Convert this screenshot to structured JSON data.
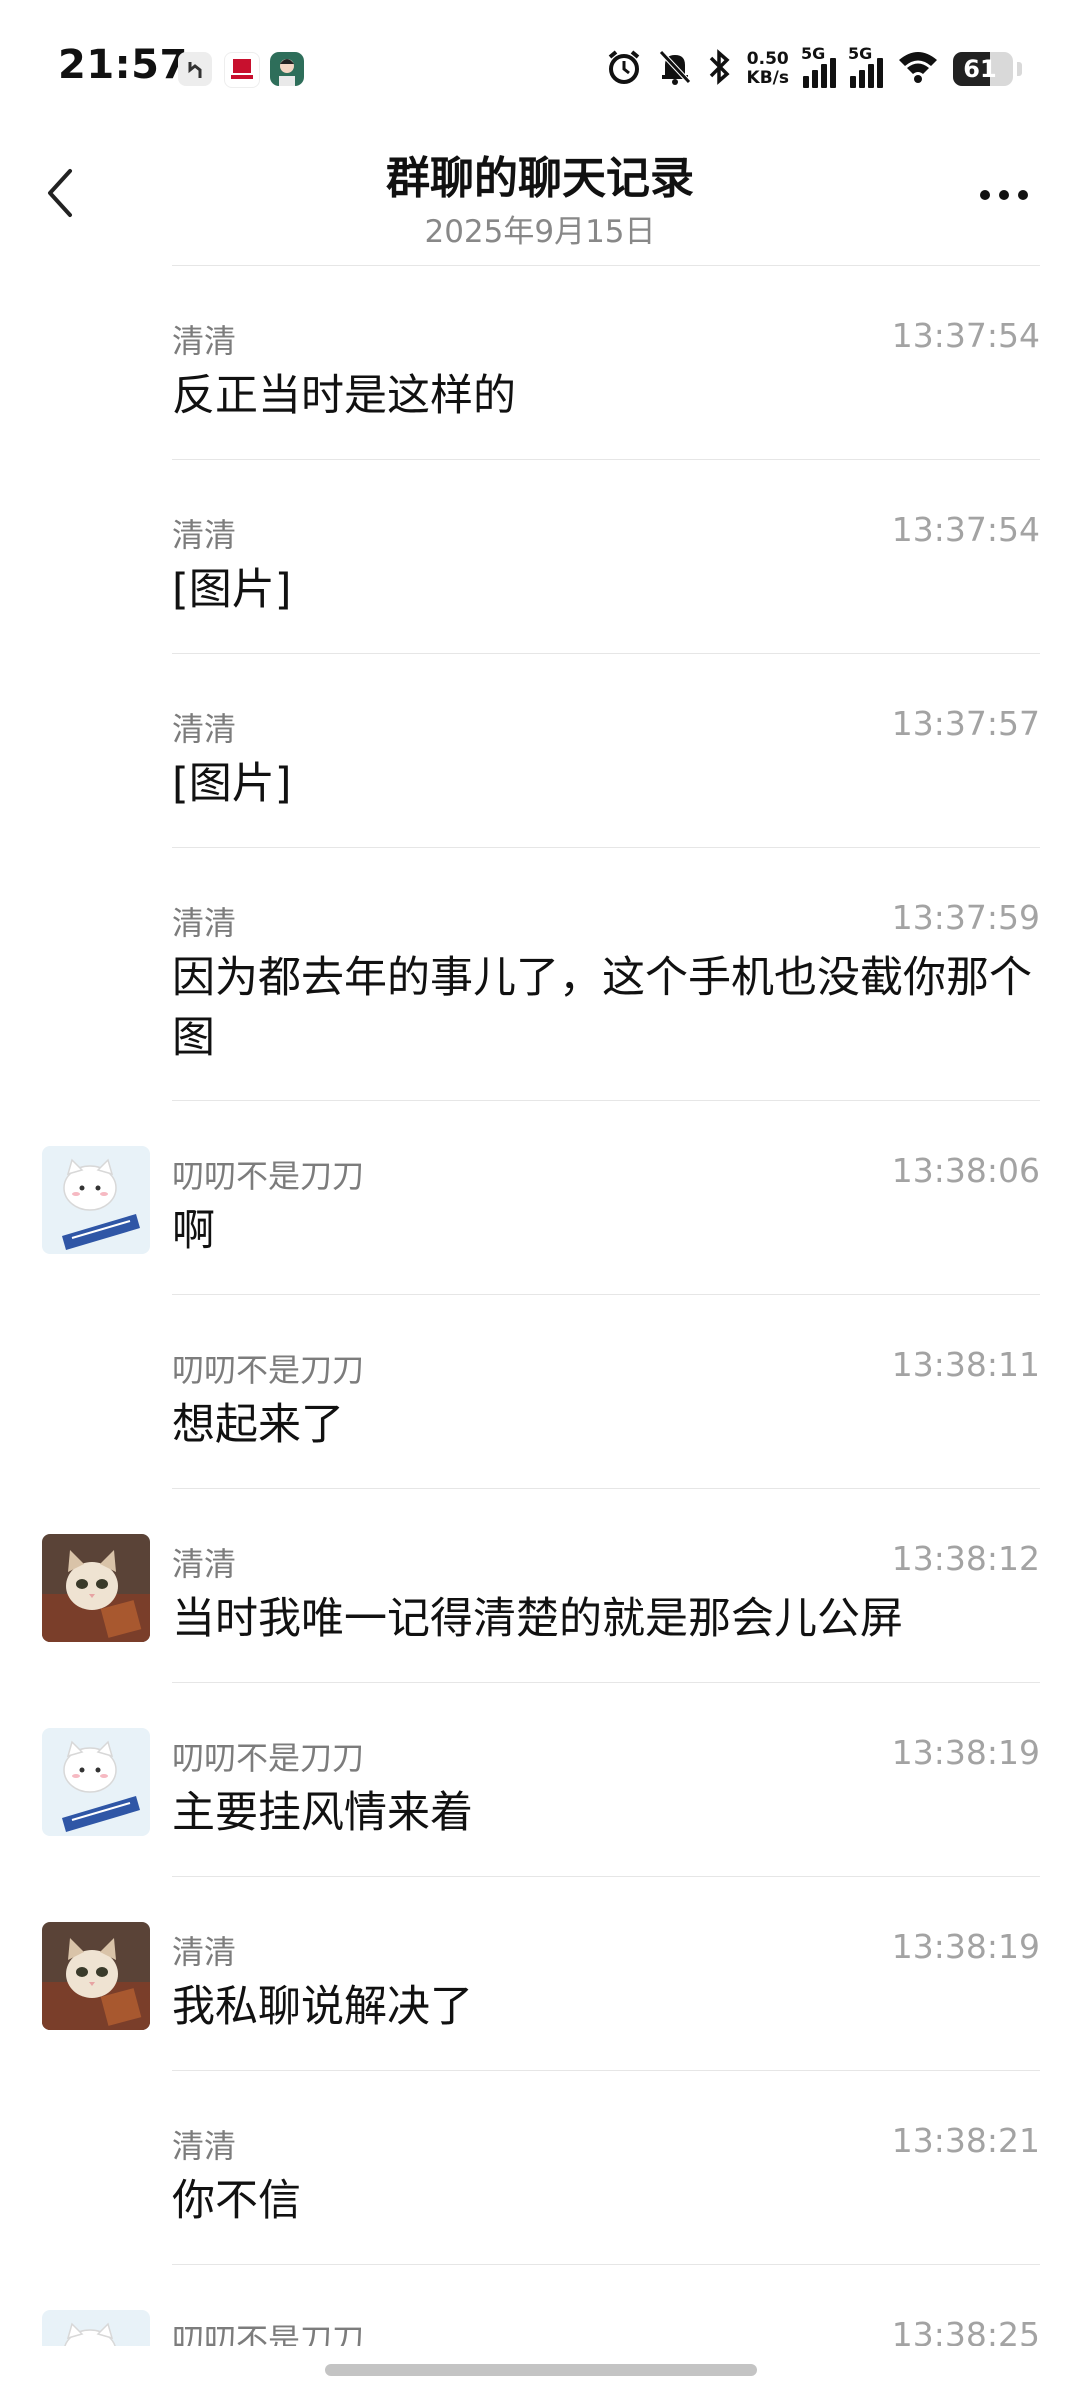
{
  "status_bar": {
    "time": "21:57",
    "net_speed_value": "0.50",
    "net_speed_unit": "KB/s",
    "signal1_label": "5G",
    "signal2_label": "5G",
    "battery": "61",
    "battery_level": 0.61
  },
  "nav": {
    "title": "群聊的聊天记录",
    "subtitle": "2025年9月15日"
  },
  "messages": [
    {
      "sender": "清清",
      "time": "13:37:54",
      "text": "反正当时是这样的",
      "avatar": "none"
    },
    {
      "sender": "清清",
      "time": "13:37:54",
      "text": "[图片]",
      "avatar": "none"
    },
    {
      "sender": "清清",
      "time": "13:37:57",
      "text": "[图片]",
      "avatar": "none"
    },
    {
      "sender": "清清",
      "time": "13:37:59",
      "text": "因为都去年的事儿了，这个手机也没截你那个图",
      "avatar": "none"
    },
    {
      "sender": "叨叨不是刀刀",
      "time": "13:38:06",
      "text": "啊",
      "avatar": "white-cat-sign"
    },
    {
      "sender": "叨叨不是刀刀",
      "time": "13:38:11",
      "text": "想起来了",
      "avatar": "none"
    },
    {
      "sender": "清清",
      "time": "13:38:12",
      "text": "当时我唯一记得清楚的就是那会儿公屏",
      "avatar": "kitten-photo"
    },
    {
      "sender": "叨叨不是刀刀",
      "time": "13:38:19",
      "text": "主要挂风情来着",
      "avatar": "white-cat-sign"
    },
    {
      "sender": "清清",
      "time": "13:38:19",
      "text": "我私聊说解决了",
      "avatar": "kitten-photo"
    },
    {
      "sender": "清清",
      "time": "13:38:21",
      "text": "你不信",
      "avatar": "none"
    },
    {
      "sender": "叨叨不是刀刀",
      "time": "13:38:25",
      "text": "",
      "avatar": "white-cat-sign"
    }
  ]
}
